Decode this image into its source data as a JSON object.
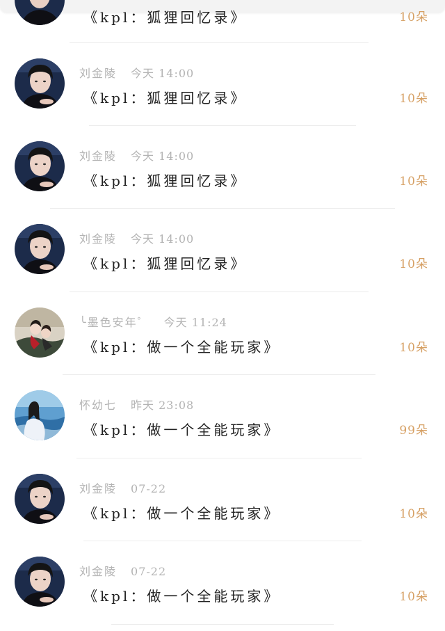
{
  "colors": {
    "name_time": "#b3b3b3",
    "title": "#222222",
    "count": "#d6a064",
    "divider": "#ececec"
  },
  "partial_item": {
    "title": "《kpl：狐狸回忆录》",
    "count": "10朵"
  },
  "items": [
    {
      "name": "刘金陵",
      "time": "今天 14:00",
      "title": "《kpl：狐狸回忆录》",
      "count": "10朵",
      "avatar": "boy-avatar"
    },
    {
      "name": "刘金陵",
      "time": "今天 14:00",
      "title": "《kpl：狐狸回忆录》",
      "count": "10朵",
      "avatar": "boy-avatar"
    },
    {
      "name": "刘金陵",
      "time": "今天 14:00",
      "title": "《kpl：狐狸回忆录》",
      "count": "10朵",
      "avatar": "boy-avatar"
    },
    {
      "name": "╰墨色安年゜",
      "time": "今天 11:24",
      "title": "《kpl：做一个全能玩家》",
      "count": "10朵",
      "avatar": "couple-avatar"
    },
    {
      "name": "怀幼七",
      "time": "昨天 23:08",
      "title": "《kpl：做一个全能玩家》",
      "count": "99朵",
      "avatar": "girl-sea-avatar"
    },
    {
      "name": "刘金陵",
      "time": "07-22",
      "title": "《kpl：做一个全能玩家》",
      "count": "10朵",
      "avatar": "boy-avatar"
    },
    {
      "name": "刘金陵",
      "time": "07-22",
      "title": "《kpl：做一个全能玩家》",
      "count": "10朵",
      "avatar": "boy-avatar"
    }
  ]
}
